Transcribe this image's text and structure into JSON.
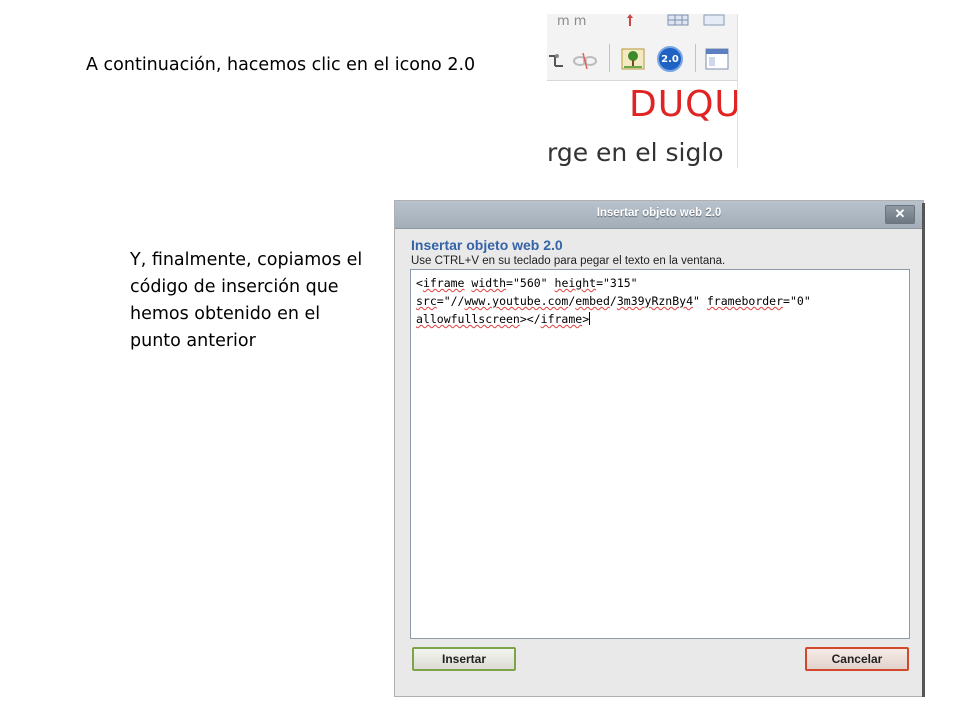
{
  "captions": {
    "step1": "A continuación, hacemos clic en el icono 2.0",
    "step2": "Y, finalmente, copiamos el código de inserción que hemos obtenido en el punto anterior"
  },
  "editor_crop": {
    "toolbar_icons": [
      "link-icon",
      "unlink-icon",
      "image-icon",
      "web20-icon",
      "template-icon"
    ],
    "badge_label": "2.0",
    "doc_title": "DUQU",
    "doc_text": "rge en el siglo",
    "colors": {
      "title": "#e02323",
      "badge": "#1f62c3"
    }
  },
  "dialog": {
    "title": "Insertar objeto web 2.0",
    "close_label": "✕",
    "heading": "Insertar objeto web 2.0",
    "instruction": "Use CTRL+V en su teclado para pegar el texto en la ventana.",
    "code_lines": [
      "<iframe width=\"560\" height=\"315\"",
      "src=\"//www.youtube.com/embed/3m39yRznBy4\" frameborder=\"0\"",
      "allowfullscreen></iframe>"
    ],
    "insert_label": "Insertar",
    "cancel_label": "Cancelar",
    "colors": {
      "heading": "#3463a8",
      "insert_border": "#7ea44a",
      "cancel_border": "#d2482c"
    }
  }
}
